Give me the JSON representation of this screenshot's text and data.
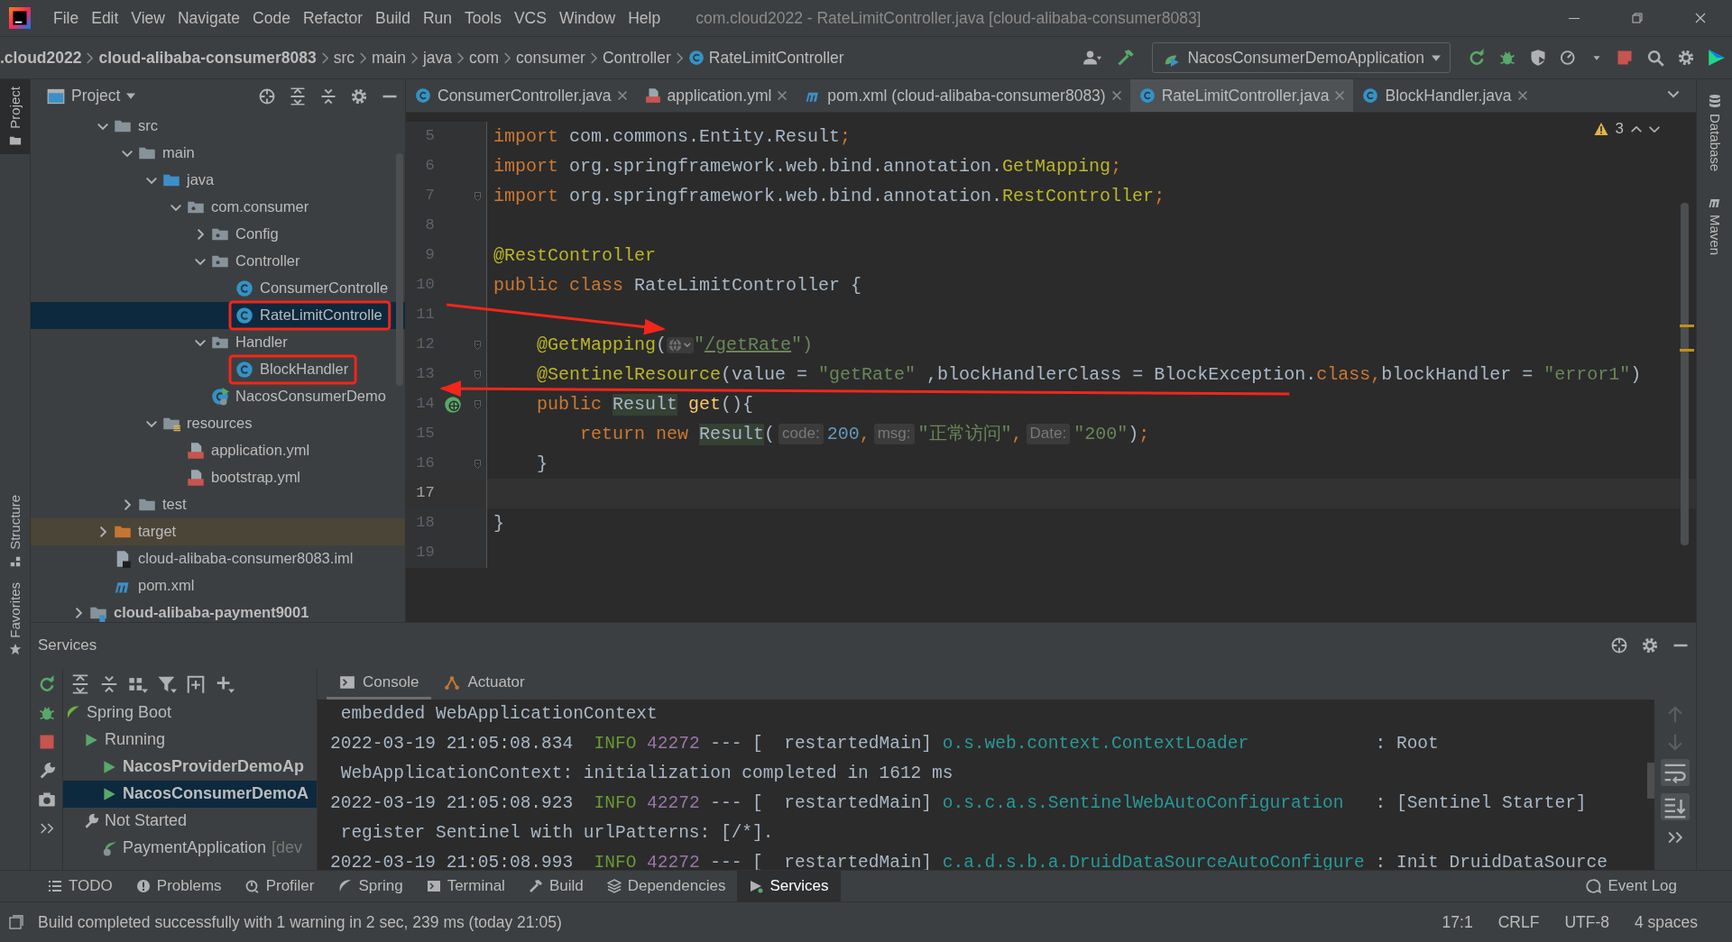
{
  "menu": {
    "items": [
      "File",
      "Edit",
      "View",
      "Navigate",
      "Code",
      "Refactor",
      "Build",
      "Run",
      "Tools",
      "VCS",
      "Window",
      "Help"
    ]
  },
  "window": {
    "title": "com.cloud2022 - RateLimitController.java [cloud-alibaba-consumer8083]"
  },
  "breadcrumbs": [
    {
      "label": ".cloud2022",
      "kind": "module"
    },
    {
      "label": "cloud-alibaba-consumer8083",
      "kind": "module"
    },
    {
      "label": "src",
      "kind": "dir"
    },
    {
      "label": "main",
      "kind": "dir"
    },
    {
      "label": "java",
      "kind": "dir"
    },
    {
      "label": "com",
      "kind": "dir"
    },
    {
      "label": "consumer",
      "kind": "dir"
    },
    {
      "label": "Controller",
      "kind": "dir"
    },
    {
      "label": "RateLimitController",
      "kind": "class"
    }
  ],
  "run_config": {
    "label": "NacosConsumerDemoApplication"
  },
  "left_tools": [
    {
      "label": "Project",
      "kind": "project",
      "selected": true
    },
    {
      "label": "Structure",
      "kind": "structure",
      "selected": false
    },
    {
      "label": "Favorites",
      "kind": "favorites",
      "selected": false
    }
  ],
  "right_tools": [
    {
      "label": "Database",
      "kind": "database"
    },
    {
      "label": "Maven",
      "kind": "maven"
    }
  ],
  "project": {
    "title": "Project",
    "items": [
      {
        "label": "src",
        "kind": "folder",
        "expanded": true,
        "selected": false,
        "boxed": false,
        "children": [
          {
            "label": "main",
            "kind": "folder",
            "expanded": true,
            "selected": false,
            "boxed": false,
            "children": [
              {
                "label": "java",
                "kind": "source-folder",
                "expanded": true,
                "selected": false,
                "boxed": false,
                "children": [
                  {
                    "label": "com.consumer",
                    "kind": "package",
                    "expanded": true,
                    "selected": false,
                    "boxed": false,
                    "children": [
                      {
                        "label": "Config",
                        "kind": "package",
                        "expanded": false,
                        "selected": false,
                        "boxed": false
                      },
                      {
                        "label": "Controller",
                        "kind": "package",
                        "expanded": true,
                        "selected": false,
                        "boxed": false,
                        "children": [
                          {
                            "label": "ConsumerControlle",
                            "kind": "class",
                            "selected": false,
                            "boxed": false
                          },
                          {
                            "label": "RateLimitControlle",
                            "kind": "class",
                            "selected": true,
                            "boxed": true
                          }
                        ]
                      },
                      {
                        "label": "Handler",
                        "kind": "package",
                        "expanded": true,
                        "selected": false,
                        "boxed": false,
                        "children": [
                          {
                            "label": "BlockHandler",
                            "kind": "class",
                            "selected": false,
                            "boxed": true
                          }
                        ]
                      },
                      {
                        "label": "NacosConsumerDemo",
                        "kind": "spring-app",
                        "selected": false,
                        "boxed": false
                      }
                    ]
                  }
                ]
              },
              {
                "label": "resources",
                "kind": "resources",
                "expanded": true,
                "selected": false,
                "boxed": false,
                "children": [
                  {
                    "label": "application.yml",
                    "kind": "yml",
                    "selected": false,
                    "boxed": false
                  },
                  {
                    "label": "bootstrap.yml",
                    "kind": "yml",
                    "selected": false,
                    "boxed": false
                  }
                ]
              }
            ]
          },
          {
            "label": "test",
            "kind": "folder",
            "expanded": false,
            "selected": false,
            "boxed": false
          }
        ]
      },
      {
        "label": "target",
        "kind": "excluded",
        "expanded": false,
        "selected": false,
        "boxed": false
      },
      {
        "label": "cloud-alibaba-consumer8083.iml",
        "kind": "iml",
        "selected": false,
        "boxed": false
      },
      {
        "label": "pom.xml",
        "kind": "maven",
        "selected": false,
        "boxed": false
      }
    ],
    "outer_items": [
      {
        "label": "cloud-alibaba-payment9001",
        "kind": "module",
        "expanded": false,
        "selected": false,
        "boxed": false
      }
    ]
  },
  "editor_tabs": [
    {
      "label": "ConsumerController.java",
      "kind": "class",
      "selected": false
    },
    {
      "label": "application.yml",
      "kind": "yml",
      "selected": false
    },
    {
      "label": "pom.xml (cloud-alibaba-consumer8083)",
      "kind": "maven",
      "selected": false
    },
    {
      "label": "RateLimitController.java",
      "kind": "class",
      "selected": true
    },
    {
      "label": "BlockHandler.java",
      "kind": "class",
      "selected": false
    }
  ],
  "editor": {
    "warning_count": "3",
    "lines": [
      {
        "number": "5",
        "current": false,
        "fold": false,
        "run_icon": false,
        "tokens": [
          {
            "text": "import ",
            "kind": "keyword"
          },
          {
            "text": "com.commons.Entity.Result",
            "kind": "plain"
          },
          {
            "text": ";",
            "kind": "keyword"
          }
        ]
      },
      {
        "number": "6",
        "current": false,
        "fold": false,
        "run_icon": false,
        "tokens": [
          {
            "text": "import ",
            "kind": "keyword"
          },
          {
            "text": "org.springframework.web.bind.annotation.",
            "kind": "plain"
          },
          {
            "text": "GetMapping",
            "kind": "annotation"
          },
          {
            "text": ";",
            "kind": "keyword"
          }
        ]
      },
      {
        "number": "7",
        "current": false,
        "fold": true,
        "run_icon": false,
        "tokens": [
          {
            "text": "import ",
            "kind": "keyword"
          },
          {
            "text": "org.springframework.web.bind.annotation.",
            "kind": "plain"
          },
          {
            "text": "RestController",
            "kind": "annotation"
          },
          {
            "text": ";",
            "kind": "keyword"
          }
        ]
      },
      {
        "number": "8",
        "current": false,
        "fold": false,
        "run_icon": false
      },
      {
        "number": "9",
        "current": false,
        "fold": false,
        "run_icon": false,
        "tokens": [
          {
            "text": "@RestController",
            "kind": "annotation"
          }
        ]
      },
      {
        "number": "10",
        "current": false,
        "fold": false,
        "run_icon": false,
        "tokens": [
          {
            "text": "public class ",
            "kind": "keyword"
          },
          {
            "text": "RateLimitController {",
            "kind": "plain"
          }
        ]
      },
      {
        "number": "11",
        "current": false,
        "fold": false,
        "run_icon": false,
        "arrow_end": true
      },
      {
        "number": "12",
        "current": false,
        "fold": true,
        "run_icon": false,
        "tokens": [
          {
            "text": "    @GetMapping",
            "kind": "annotation"
          },
          {
            "text": "(",
            "kind": "plain"
          },
          {
            "kind": "globe"
          },
          {
            "text": "\"",
            "kind": "string"
          },
          {
            "text": "/getRate",
            "kind": "url"
          },
          {
            "text": "\")",
            "kind": "string"
          }
        ]
      },
      {
        "number": "13",
        "current": false,
        "fold": true,
        "run_icon": false,
        "arrow_start": true,
        "tokens": [
          {
            "text": "    @SentinelResource",
            "kind": "annotation"
          },
          {
            "text": "(value = ",
            "kind": "plain"
          },
          {
            "text": "\"getRate\"",
            "kind": "string"
          },
          {
            "text": " ,blockHandlerClass = BlockException.",
            "kind": "plain"
          },
          {
            "text": "class,",
            "kind": "keyword"
          },
          {
            "text": "blockHandler = ",
            "kind": "plain"
          },
          {
            "text": "\"error1\"",
            "kind": "string"
          },
          {
            "text": ")",
            "kind": "plain"
          }
        ]
      },
      {
        "number": "14",
        "current": false,
        "fold": true,
        "run_icon": true,
        "tokens": [
          {
            "text": "    public ",
            "kind": "keyword"
          },
          {
            "text": "Result",
            "kind": "usage"
          },
          {
            "text": " get",
            "kind": "method"
          },
          {
            "text": "(){",
            "kind": "plain"
          }
        ]
      },
      {
        "number": "15",
        "current": false,
        "fold": false,
        "run_icon": false,
        "tokens": [
          {
            "text": "        return new ",
            "kind": "keyword"
          },
          {
            "text": "Result",
            "kind": "usage"
          },
          {
            "text": "(",
            "kind": "plain"
          },
          {
            "text": "code:",
            "kind": "hint"
          },
          {
            "text": "200",
            "kind": "number"
          },
          {
            "text": ",",
            "kind": "keyword"
          },
          {
            "text": "msg:",
            "kind": "hint"
          },
          {
            "text": "\"正常访问\"",
            "kind": "string"
          },
          {
            "text": ",",
            "kind": "keyword"
          },
          {
            "text": "Date:",
            "kind": "hint"
          },
          {
            "text": "\"200\"",
            "kind": "string"
          },
          {
            "text": ")",
            "kind": "plain"
          },
          {
            "text": ";",
            "kind": "keyword"
          }
        ]
      },
      {
        "number": "16",
        "current": false,
        "fold": true,
        "run_icon": false,
        "tokens": [
          {
            "text": "    }",
            "kind": "plain"
          }
        ]
      },
      {
        "number": "17",
        "current": true,
        "fold": false,
        "run_icon": false
      },
      {
        "number": "18",
        "current": false,
        "fold": false,
        "run_icon": false,
        "tokens": [
          {
            "text": "}",
            "kind": "plain"
          }
        ]
      },
      {
        "number": "19",
        "current": false,
        "fold": false,
        "run_icon": false
      }
    ]
  },
  "services": {
    "title": "Services",
    "tree": [
      {
        "label": "Spring Boot",
        "kind": "spring",
        "selected": false,
        "children": [
          {
            "label": "Running",
            "kind": "running",
            "selected": false,
            "children": [
              {
                "label": "NacosProviderDemoAp",
                "kind": "app",
                "selected": false
              },
              {
                "label": "NacosConsumerDemoA",
                "kind": "app",
                "selected": true
              }
            ]
          },
          {
            "label": "Not Started",
            "kind": "not-started",
            "selected": false,
            "children": [
              {
                "label": "PaymentApplication",
                "suffix": "[dev",
                "kind": "spring-app",
                "selected": false
              }
            ]
          }
        ]
      }
    ],
    "tabs": [
      {
        "label": "Console",
        "kind": "console",
        "selected": true
      },
      {
        "label": "Actuator",
        "kind": "actuator",
        "selected": false
      }
    ],
    "console": [
      [
        {
          "text": " embedded WebApplicationContext",
          "kind": "plain"
        }
      ],
      [
        {
          "text": "2022-03-19 21:05:08.834  ",
          "kind": "plain"
        },
        {
          "text": "INFO ",
          "kind": "info"
        },
        {
          "text": "42272",
          "kind": "pid"
        },
        {
          "text": " --- [  restartedMain] ",
          "kind": "plain"
        },
        {
          "text": "o.s.web.context.ContextLoader           ",
          "kind": "logger"
        },
        {
          "text": " : Root",
          "kind": "plain"
        }
      ],
      [
        {
          "text": " WebApplicationContext: initialization completed in 1612 ms",
          "kind": "plain"
        }
      ],
      [
        {
          "text": "2022-03-19 21:05:08.923  ",
          "kind": "plain"
        },
        {
          "text": "INFO ",
          "kind": "info"
        },
        {
          "text": "42272",
          "kind": "pid"
        },
        {
          "text": " --- [  restartedMain] ",
          "kind": "plain"
        },
        {
          "text": "o.s.c.a.s.SentinelWebAutoConfiguration  ",
          "kind": "logger"
        },
        {
          "text": " : [Sentinel Starter]",
          "kind": "plain"
        }
      ],
      [
        {
          "text": " register Sentinel with urlPatterns: [/*].",
          "kind": "plain"
        }
      ],
      [
        {
          "text": "2022-03-19 21:05:08.993  ",
          "kind": "plain"
        },
        {
          "text": "INFO ",
          "kind": "info"
        },
        {
          "text": "42272",
          "kind": "pid"
        },
        {
          "text": " --- [  restartedMain] ",
          "kind": "plain"
        },
        {
          "text": "c.a.d.s.b.a.DruidDataSourceAutoConfigure",
          "kind": "logger"
        },
        {
          "text": " : Init DruidDataSource",
          "kind": "plain"
        }
      ]
    ]
  },
  "bottom_tabs": [
    {
      "label": "TODO",
      "kind": "todo",
      "selected": false
    },
    {
      "label": "Problems",
      "kind": "problems",
      "selected": false
    },
    {
      "label": "Profiler",
      "kind": "profiler",
      "selected": false
    },
    {
      "label": "Spring",
      "kind": "spring",
      "selected": false
    },
    {
      "label": "Terminal",
      "kind": "terminal",
      "selected": false
    },
    {
      "label": "Build",
      "kind": "build",
      "selected": false
    },
    {
      "label": "Dependencies",
      "kind": "dependencies",
      "selected": false
    },
    {
      "label": "Services",
      "kind": "services",
      "selected": true
    }
  ],
  "event_log": {
    "label": "Event Log"
  },
  "status": {
    "message": "Build completed successfully with 1 warning in 2 sec, 239 ms (today 21:05)",
    "position": "17:1",
    "line_separator": "CRLF",
    "encoding": "UTF-8",
    "indent": "4 spaces"
  }
}
